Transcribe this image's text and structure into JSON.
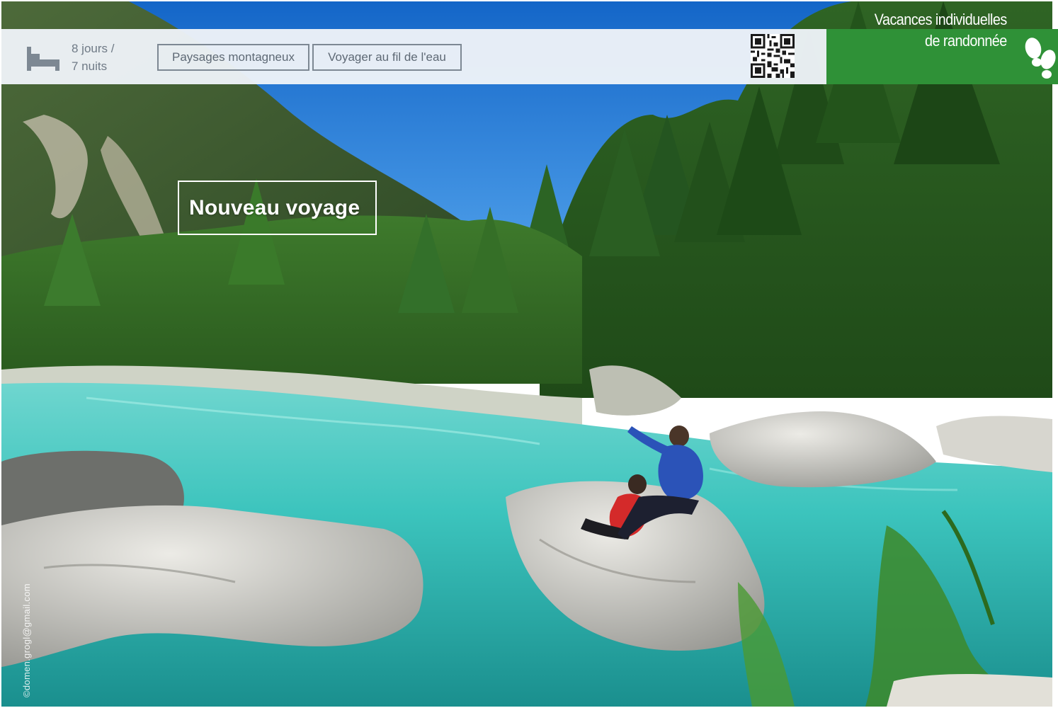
{
  "header": {
    "duration_days": "8 jours /",
    "duration_nights": "7 nuits",
    "tags": [
      "Paysages montagneux",
      "Voyager au fil de l'eau"
    ],
    "brand_line1": "Vacances individuelles",
    "brand_line2": "de randonnée"
  },
  "headline": "Nouveau voyage",
  "credit": "©domen.grogl@gmail.com",
  "icons": {
    "duration": "bed-icon",
    "qr": "qr-code-icon",
    "brand": "footprints-icon"
  },
  "colors": {
    "brand_green": "#2f9137",
    "info_bar": "#eef3f8",
    "tag_border": "#7d8893",
    "text_gray": "#6f7a86",
    "river": "#39c4bd",
    "sky": "#1f7fd8"
  }
}
